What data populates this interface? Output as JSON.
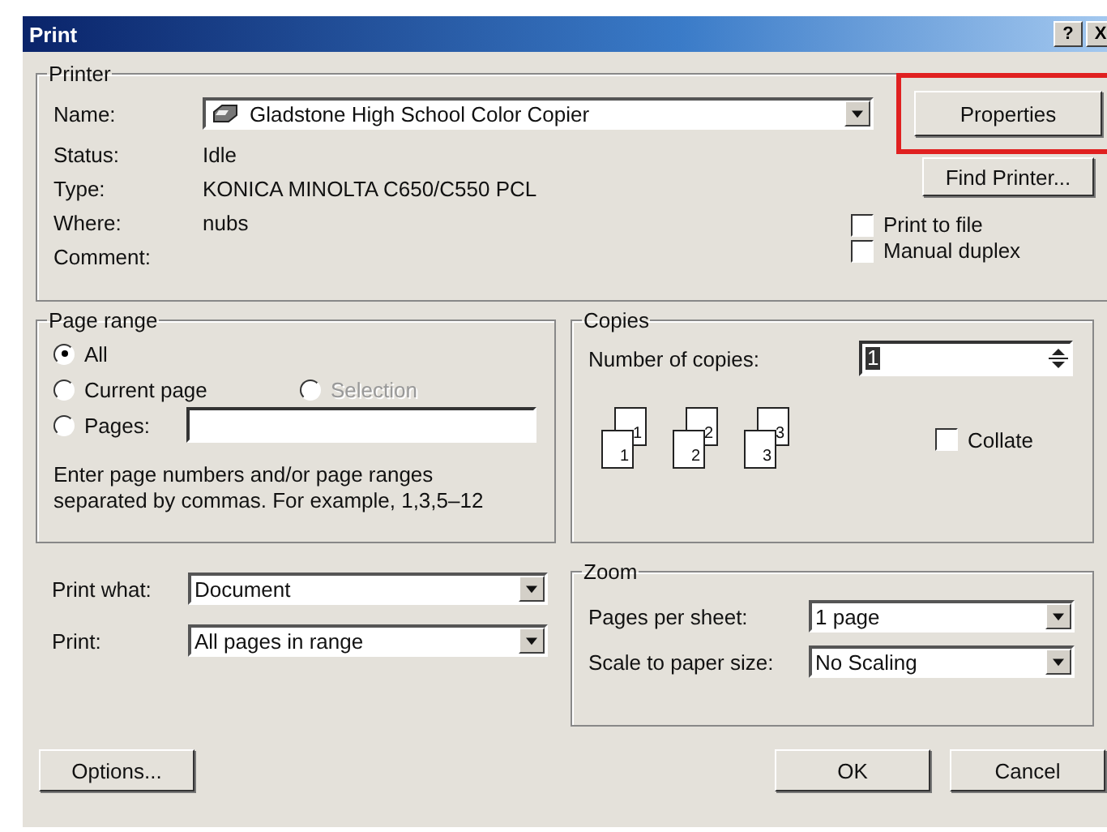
{
  "window": {
    "title": "Print",
    "title_buttons": [
      "?",
      "X"
    ]
  },
  "printer": {
    "legend": "Printer",
    "name_label": "Name:",
    "name_value": "Gladstone High School Color Copier",
    "properties_button": {
      "label": "Properties",
      "highlighted": true
    },
    "find_printer_button": "Find Printer...",
    "info": [
      {
        "label": "Status:",
        "value": "Idle"
      },
      {
        "label": "Type:",
        "value": "KONICA MINOLTA C650/C550 PCL"
      },
      {
        "label": "Where:",
        "value": "nubs"
      },
      {
        "label": "Comment:"
      }
    ],
    "options": [
      {
        "label": "Print to file",
        "checked": false
      },
      {
        "label": "Manual duplex",
        "checked": false
      }
    ]
  },
  "page_range": {
    "legend": "Page range",
    "options": [
      {
        "label": "All",
        "selected": true,
        "disabled": false
      },
      {
        "label": "Current page",
        "selected": false,
        "disabled": false
      },
      {
        "label": "Selection",
        "selected": false,
        "disabled": true
      },
      {
        "label": "Pages:",
        "selected": false,
        "disabled": false
      }
    ],
    "hint_lines": [
      "Enter page numbers and/or page ranges",
      "separated by commas.  For example, 1,3,5–12"
    ]
  },
  "copies": {
    "legend": "Copies",
    "label": "Number of copies:",
    "value": "1",
    "stacks": [
      {
        "back": "1",
        "front": "1"
      },
      {
        "back": "2",
        "front": "2"
      },
      {
        "back": "3",
        "front": "3"
      }
    ],
    "collate": {
      "label": "Collate",
      "checked": false
    }
  },
  "print_settings": [
    {
      "label": "Print what:",
      "value": "Document"
    },
    {
      "label": "Print:",
      "value": "All pages in range"
    }
  ],
  "zoom": {
    "legend": "Zoom",
    "rows": [
      {
        "label": "Pages per sheet:",
        "value": "1 page"
      },
      {
        "label": "Scale to paper size:",
        "value": "No Scaling"
      }
    ]
  },
  "buttons": {
    "options": "Options...",
    "ok": "OK",
    "cancel": "Cancel"
  }
}
